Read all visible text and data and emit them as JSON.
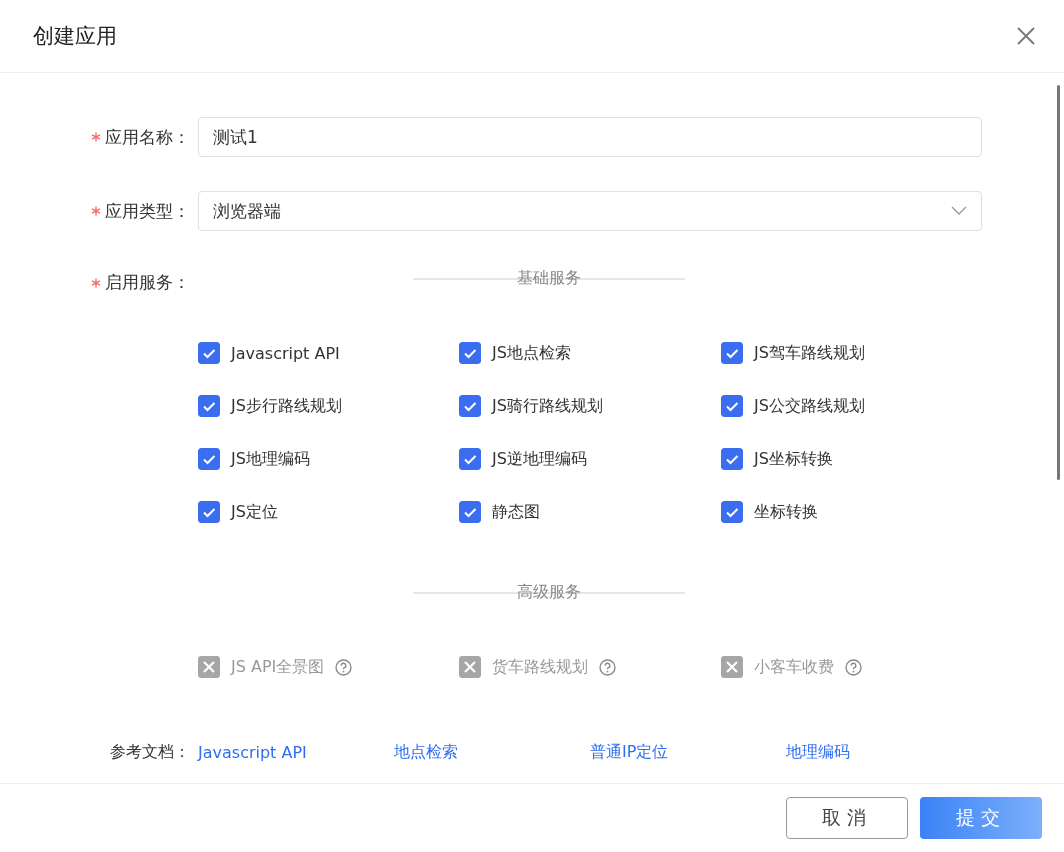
{
  "dialog": {
    "title": "创建应用"
  },
  "fields": [
    {
      "label": "应用名称：",
      "required": true,
      "kind": "text",
      "value": "测试1"
    },
    {
      "label": "应用类型：",
      "required": true,
      "kind": "select",
      "value": "浏览器端"
    }
  ],
  "services": {
    "label": "启用服务：",
    "required": true,
    "groups": [
      {
        "title": "基础服务",
        "items": [
          {
            "label": "Javascript API",
            "checked": true,
            "disabled": false,
            "help": false
          },
          {
            "label": "JS地点检索",
            "checked": true,
            "disabled": false,
            "help": false
          },
          {
            "label": "JS驾车路线规划",
            "checked": true,
            "disabled": false,
            "help": false
          },
          {
            "label": "JS步行路线规划",
            "checked": true,
            "disabled": false,
            "help": false
          },
          {
            "label": "JS骑行路线规划",
            "checked": true,
            "disabled": false,
            "help": false
          },
          {
            "label": "JS公交路线规划",
            "checked": true,
            "disabled": false,
            "help": false
          },
          {
            "label": "JS地理编码",
            "checked": true,
            "disabled": false,
            "help": false
          },
          {
            "label": "JS逆地理编码",
            "checked": true,
            "disabled": false,
            "help": false
          },
          {
            "label": "JS坐标转换",
            "checked": true,
            "disabled": false,
            "help": false
          },
          {
            "label": "JS定位",
            "checked": true,
            "disabled": false,
            "help": false
          },
          {
            "label": "静态图",
            "checked": true,
            "disabled": false,
            "help": false
          },
          {
            "label": "坐标转换",
            "checked": true,
            "disabled": false,
            "help": false
          }
        ]
      },
      {
        "title": "高级服务",
        "items": [
          {
            "label": "JS API全景图",
            "checked": false,
            "disabled": true,
            "help": true
          },
          {
            "label": "货车路线规划",
            "checked": false,
            "disabled": true,
            "help": true
          },
          {
            "label": "小客车收费",
            "checked": false,
            "disabled": true,
            "help": true
          }
        ]
      }
    ]
  },
  "docs": {
    "label": "参考文档：",
    "links": [
      "Javascript API",
      "地点检索",
      "普通IP定位",
      "地理编码"
    ]
  },
  "buttons": [
    {
      "label": "取消",
      "kind": "secondary"
    },
    {
      "label": "提交",
      "kind": "primary"
    }
  ]
}
